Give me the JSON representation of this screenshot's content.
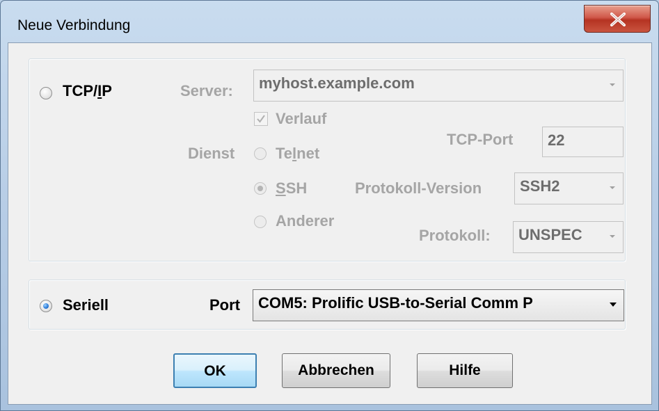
{
  "window": {
    "title": "Neue Verbindung",
    "close_glyph": "X"
  },
  "tcp": {
    "radio_label": "TCP/IP",
    "selected": false,
    "server_label": "Server:",
    "server_value": "myhost.example.com",
    "history_label": "Verlauf",
    "history_checked": true,
    "service_label": "Dienst",
    "telnet_label": "Telnet",
    "ssh_label": "SSH",
    "other_label": "Anderer",
    "selected_service": "SSH",
    "tcp_port_label": "TCP-Port",
    "tcp_port_value": "22",
    "protocol_version_label": "Protokoll-Version",
    "protocol_version_value": "SSH2",
    "protocol_label": "Protokoll:",
    "protocol_value": "UNSPEC"
  },
  "serial": {
    "radio_label": "Seriell",
    "selected": true,
    "port_label": "Port",
    "port_value": "COM5: Prolific USB-to-Serial Comm P"
  },
  "buttons": {
    "ok": "OK",
    "cancel": "Abbrechen",
    "help": "Hilfe"
  },
  "icons": {
    "close": "close-icon",
    "dropdown": "chevron-down-icon",
    "check": "check-icon"
  },
  "colors": {
    "title_bar": "#b7cde6",
    "close_button": "#c9543f",
    "dialog_bg": "#f0f0f0",
    "disabled_text": "#a5a5a5",
    "default_button_border": "#3c7fb1"
  }
}
